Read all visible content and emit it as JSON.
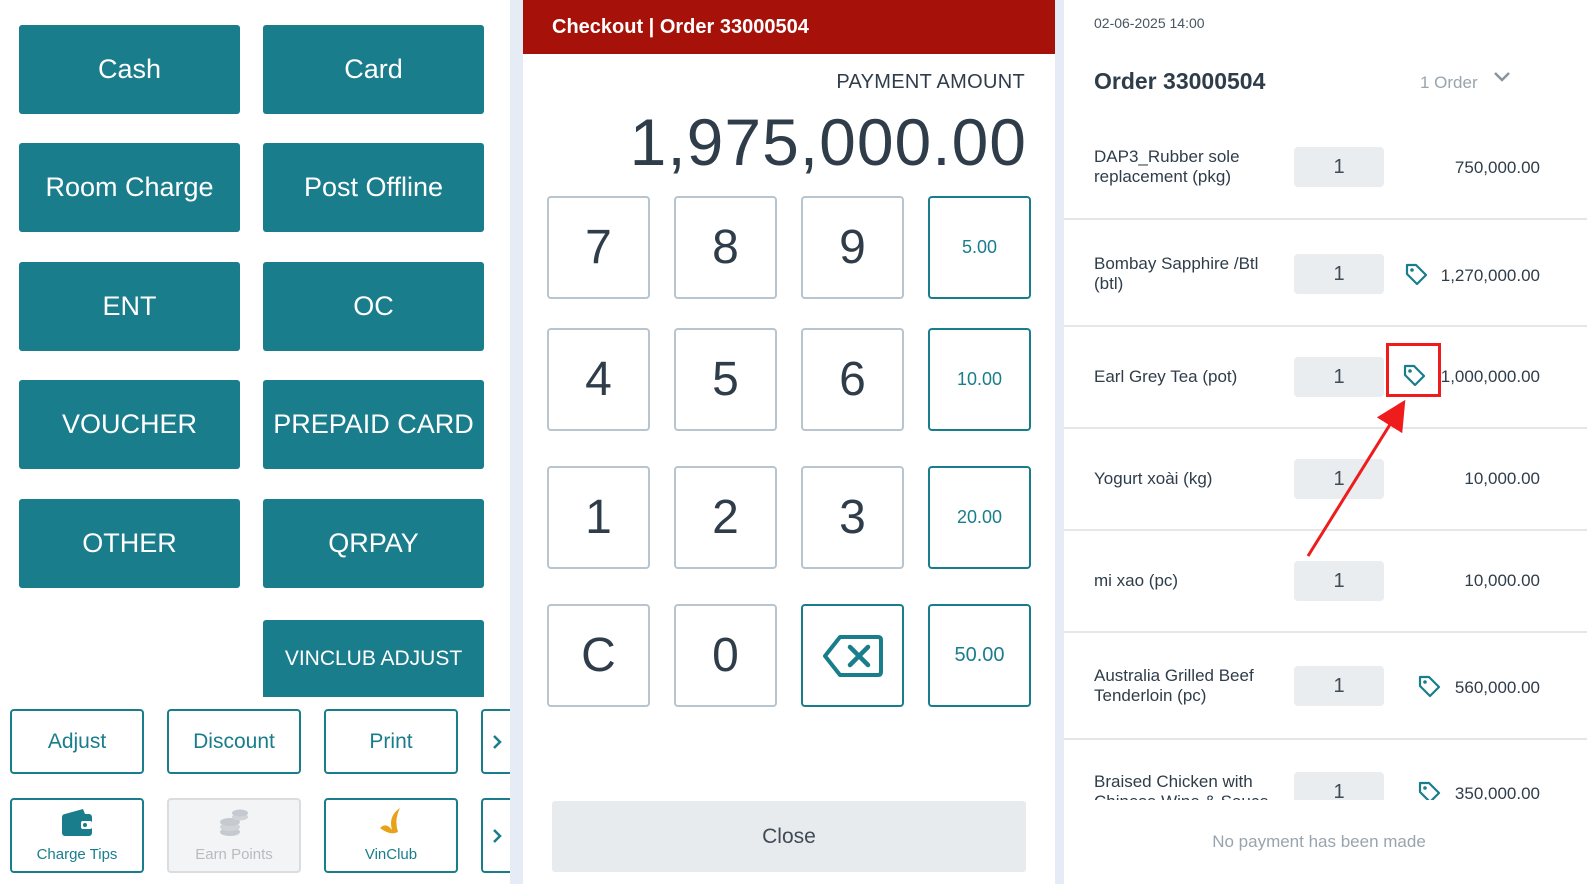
{
  "payment_methods": {
    "cash": "Cash",
    "card": "Card",
    "room_charge": "Room Charge",
    "post_offline": "Post Offline",
    "ent": "ENT",
    "oc": "OC",
    "voucher": "VOUCHER",
    "prepaid_card": "PREPAID CARD",
    "other": "OTHER",
    "qrpay": "QRPAY",
    "vinclub_adjust": "VINCLUB ADJUST"
  },
  "actions": {
    "adjust": "Adjust",
    "discount": "Discount",
    "print": "Print",
    "charge_tips": "Charge Tips",
    "earn_points": "Earn Points",
    "vinclub": "VinClub"
  },
  "checkout": {
    "header": "Checkout | Order 33000504",
    "payment_label": "PAYMENT AMOUNT",
    "payment_amount": "1,975,000.00",
    "keys": [
      "7",
      "8",
      "9",
      "4",
      "5",
      "6",
      "1",
      "2",
      "3",
      "C",
      "0"
    ],
    "quick_amounts": [
      "5.00",
      "10.00",
      "20.00",
      "50.00"
    ],
    "close": "Close"
  },
  "order": {
    "datetime": "02-06-2025 14:00",
    "title": "Order 33000504",
    "order_count": "1 Order",
    "items": [
      {
        "name": "DAP3_Rubber sole replacement (pkg)",
        "qty": "1",
        "price": "750,000.00",
        "tag": false
      },
      {
        "name": "Bombay Sapphire /Btl (btl)",
        "qty": "1",
        "price": "1,270,000.00",
        "tag": true
      },
      {
        "name": "Earl Grey Tea (pot)",
        "qty": "1",
        "price": "1,000,000.00",
        "tag": true
      },
      {
        "name": "Yogurt xoài (kg)",
        "qty": "1",
        "price": "10,000.00",
        "tag": false
      },
      {
        "name": "mi xao (pc)",
        "qty": "1",
        "price": "10,000.00",
        "tag": false
      },
      {
        "name": "Australia Grilled Beef Tenderloin (pc)",
        "qty": "1",
        "price": "560,000.00",
        "tag": true
      },
      {
        "name": "Braised Chicken with Chinese Wine & Sauce (pc)",
        "qty": "1",
        "price": "350,000.00",
        "tag": true
      }
    ],
    "no_payment": "No payment has been made"
  },
  "colors": {
    "teal": "#1a7d8c",
    "header_red": "#a6120a",
    "annotation_red": "#ee1c1c"
  }
}
